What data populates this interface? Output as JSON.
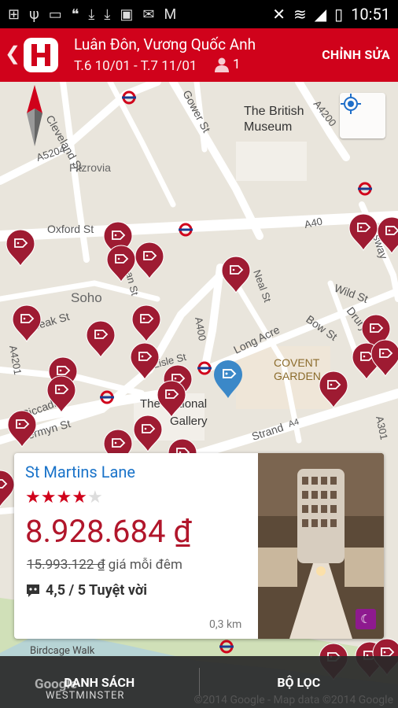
{
  "status": {
    "time": "10:51"
  },
  "appbar": {
    "city": "Luân Đôn, Vương Quốc Anh",
    "dates": "T.6 10/01 - T.7 11/01",
    "guests": "1",
    "edit": "CHỈNH SỬA"
  },
  "map": {
    "labels": {
      "cleveland": "Cleveland St",
      "a5204": "A5204",
      "gower": "Gower St",
      "british": "The British",
      "museum": "Museum",
      "a4200": "A4200",
      "fitzrovia": "Fitzrovia",
      "oxford": "Oxford St",
      "a40": "A40",
      "soho": "Soho",
      "wild": "Wild St",
      "beak": "Beak St",
      "bow": "Bow St",
      "a4201": "A4201",
      "a400": "A400",
      "long": "Long Acre",
      "covent1": "COVENT",
      "covent2": "GARDEN",
      "piccadilly": "Piccadilly",
      "jermyn": "Jermyn St",
      "national1": "The National",
      "national2": "Gallery",
      "strand": "Strand",
      "a4": "A4",
      "a301": "A301",
      "drury": "Drury",
      "sway": "sway",
      "lisle": "Lisle St",
      "dean": "ean St",
      "neal": "Neal St"
    },
    "birdcage": "Birdcage Walk",
    "westminster": "WESTMINSTER",
    "google": "Google",
    "copyright": "©2014 Google - Map data ©2014 Google"
  },
  "card": {
    "name": "St Martins Lane",
    "stars": 4,
    "price": "8.928.684 ₫",
    "old_price": "15.993.122 ₫",
    "per_night": "giá mỗi đêm",
    "rating": "4,5 / 5 Tuyệt vời",
    "distance": "0,3 km"
  },
  "bottom": {
    "list": "DANH SÁCH",
    "filter": "BỘ LỌC"
  }
}
